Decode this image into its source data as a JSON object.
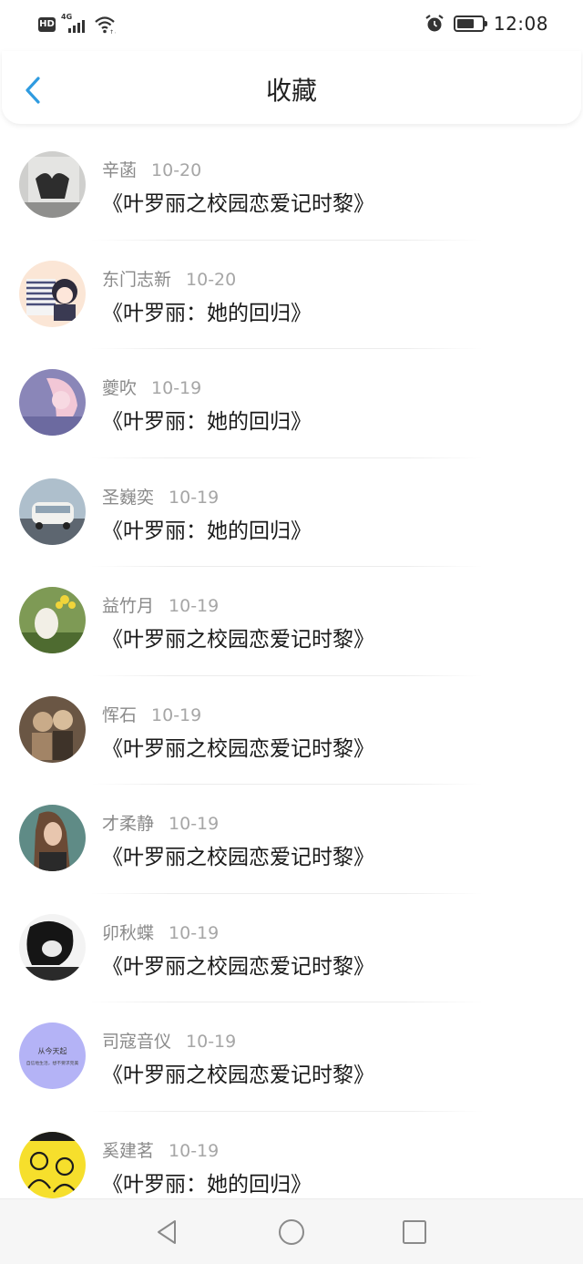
{
  "status_bar": {
    "hd": "HD",
    "network": "4G",
    "time": "12:08",
    "battery_level": 0.7
  },
  "header": {
    "title": "收藏",
    "back_icon": "chevron-left-icon",
    "accent": "#2f9be0"
  },
  "favorites": [
    {
      "name": "辛菡",
      "date": "10-20",
      "title": "《叶罗丽之校园恋爱记时黎》"
    },
    {
      "name": "东门志新",
      "date": "10-20",
      "title": "《叶罗丽：她的回归》"
    },
    {
      "name": "夔吹",
      "date": "10-19",
      "title": "《叶罗丽：她的回归》"
    },
    {
      "name": "圣巍奕",
      "date": "10-19",
      "title": "《叶罗丽：她的回归》"
    },
    {
      "name": "益竹月",
      "date": "10-19",
      "title": "《叶罗丽之校园恋爱记时黎》"
    },
    {
      "name": "恽石",
      "date": "10-19",
      "title": "《叶罗丽之校园恋爱记时黎》"
    },
    {
      "name": "才柔静",
      "date": "10-19",
      "title": "《叶罗丽之校园恋爱记时黎》"
    },
    {
      "name": "卯秋蝶",
      "date": "10-19",
      "title": "《叶罗丽之校园恋爱记时黎》"
    },
    {
      "name": "司寇音仪",
      "date": "10-19",
      "title": "《叶罗丽之校园恋爱记时黎》",
      "avatar_text": [
        "从今天起",
        "自信地生活，想不要求完美"
      ]
    },
    {
      "name": "奚建茗",
      "date": "10-19",
      "title": "《叶罗丽：她的回归》"
    }
  ],
  "nav_bar": {
    "back_icon": "triangle-back-icon",
    "home_icon": "circle-home-icon",
    "recent_icon": "square-recents-icon"
  }
}
